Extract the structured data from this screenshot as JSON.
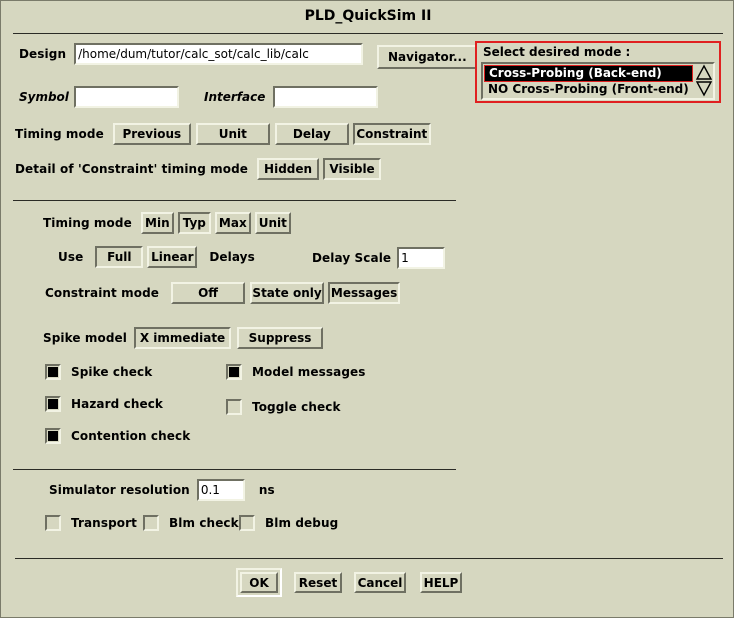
{
  "window": {
    "title": "PLD_QuickSim II"
  },
  "design": {
    "design_label": "Design",
    "design_value": "/home/dum/tutor/calc_sot/calc_lib/calc",
    "navigator_label": "Navigator...",
    "symbol_label": "Symbol",
    "symbol_value": "",
    "interface_label": "Interface",
    "interface_value": ""
  },
  "mode_panel": {
    "title": "Select desired mode :",
    "border_color": "#e02020",
    "items": [
      {
        "label": "Cross-Probing (Back-end)",
        "selected": true
      },
      {
        "label": "NO Cross-Probing (Front-end)",
        "selected": false
      }
    ],
    "scroll_up_icon": "triangle-up-icon",
    "scroll_down_icon": "triangle-down-icon"
  },
  "timing_top": {
    "label": "Timing mode",
    "options": [
      {
        "label": "Previous",
        "selected": false
      },
      {
        "label": "Unit",
        "selected": false
      },
      {
        "label": "Delay",
        "selected": false
      },
      {
        "label": "Constraint",
        "selected": true
      }
    ]
  },
  "detail": {
    "label": "Detail of 'Constraint' timing mode",
    "options": [
      {
        "label": "Hidden",
        "selected": false
      },
      {
        "label": "Visible",
        "selected": true
      }
    ]
  },
  "timing_detail": {
    "label": "Timing mode",
    "options": [
      {
        "label": "Min",
        "selected": false
      },
      {
        "label": "Typ",
        "selected": true
      },
      {
        "label": "Max",
        "selected": false
      },
      {
        "label": "Unit",
        "selected": false
      }
    ]
  },
  "delays": {
    "use_label": "Use",
    "options": [
      {
        "label": "Full",
        "selected": true
      },
      {
        "label": "Linear",
        "selected": false
      }
    ],
    "suffix_label": "Delays",
    "scale_label": "Delay Scale",
    "scale_value": "1"
  },
  "constraint_mode": {
    "label": "Constraint mode",
    "options": [
      {
        "label": "Off",
        "selected": false
      },
      {
        "label": "State only",
        "selected": false
      },
      {
        "label": "Messages",
        "selected": true
      }
    ]
  },
  "spike_model": {
    "label": "Spike model",
    "options": [
      {
        "label": "X immediate",
        "selected": true
      },
      {
        "label": "Suppress",
        "selected": false
      }
    ]
  },
  "checks": {
    "left": [
      {
        "label": "Spike check",
        "checked": true
      },
      {
        "label": "Hazard check",
        "checked": true
      },
      {
        "label": "Contention check",
        "checked": true
      }
    ],
    "right": [
      {
        "label": "Model messages",
        "checked": true
      },
      {
        "label": "Toggle check",
        "checked": false
      }
    ]
  },
  "resolution": {
    "label": "Simulator resolution",
    "value": "0.1",
    "unit": "ns"
  },
  "flags": [
    {
      "label": "Transport",
      "checked": false
    },
    {
      "label": "Blm check",
      "checked": false
    },
    {
      "label": "Blm debug",
      "checked": false
    }
  ],
  "actions": [
    {
      "label": "OK",
      "default": true
    },
    {
      "label": "Reset",
      "default": false
    },
    {
      "label": "Cancel",
      "default": false
    },
    {
      "label": "HELP",
      "default": false
    }
  ],
  "theme": {
    "background": "#d6d7c0",
    "bevel_light": "#f2f3e4",
    "bevel_dark": "#6f7062",
    "text": "#000000",
    "field_bg": "#ffffff",
    "accent_red": "#e02020"
  }
}
